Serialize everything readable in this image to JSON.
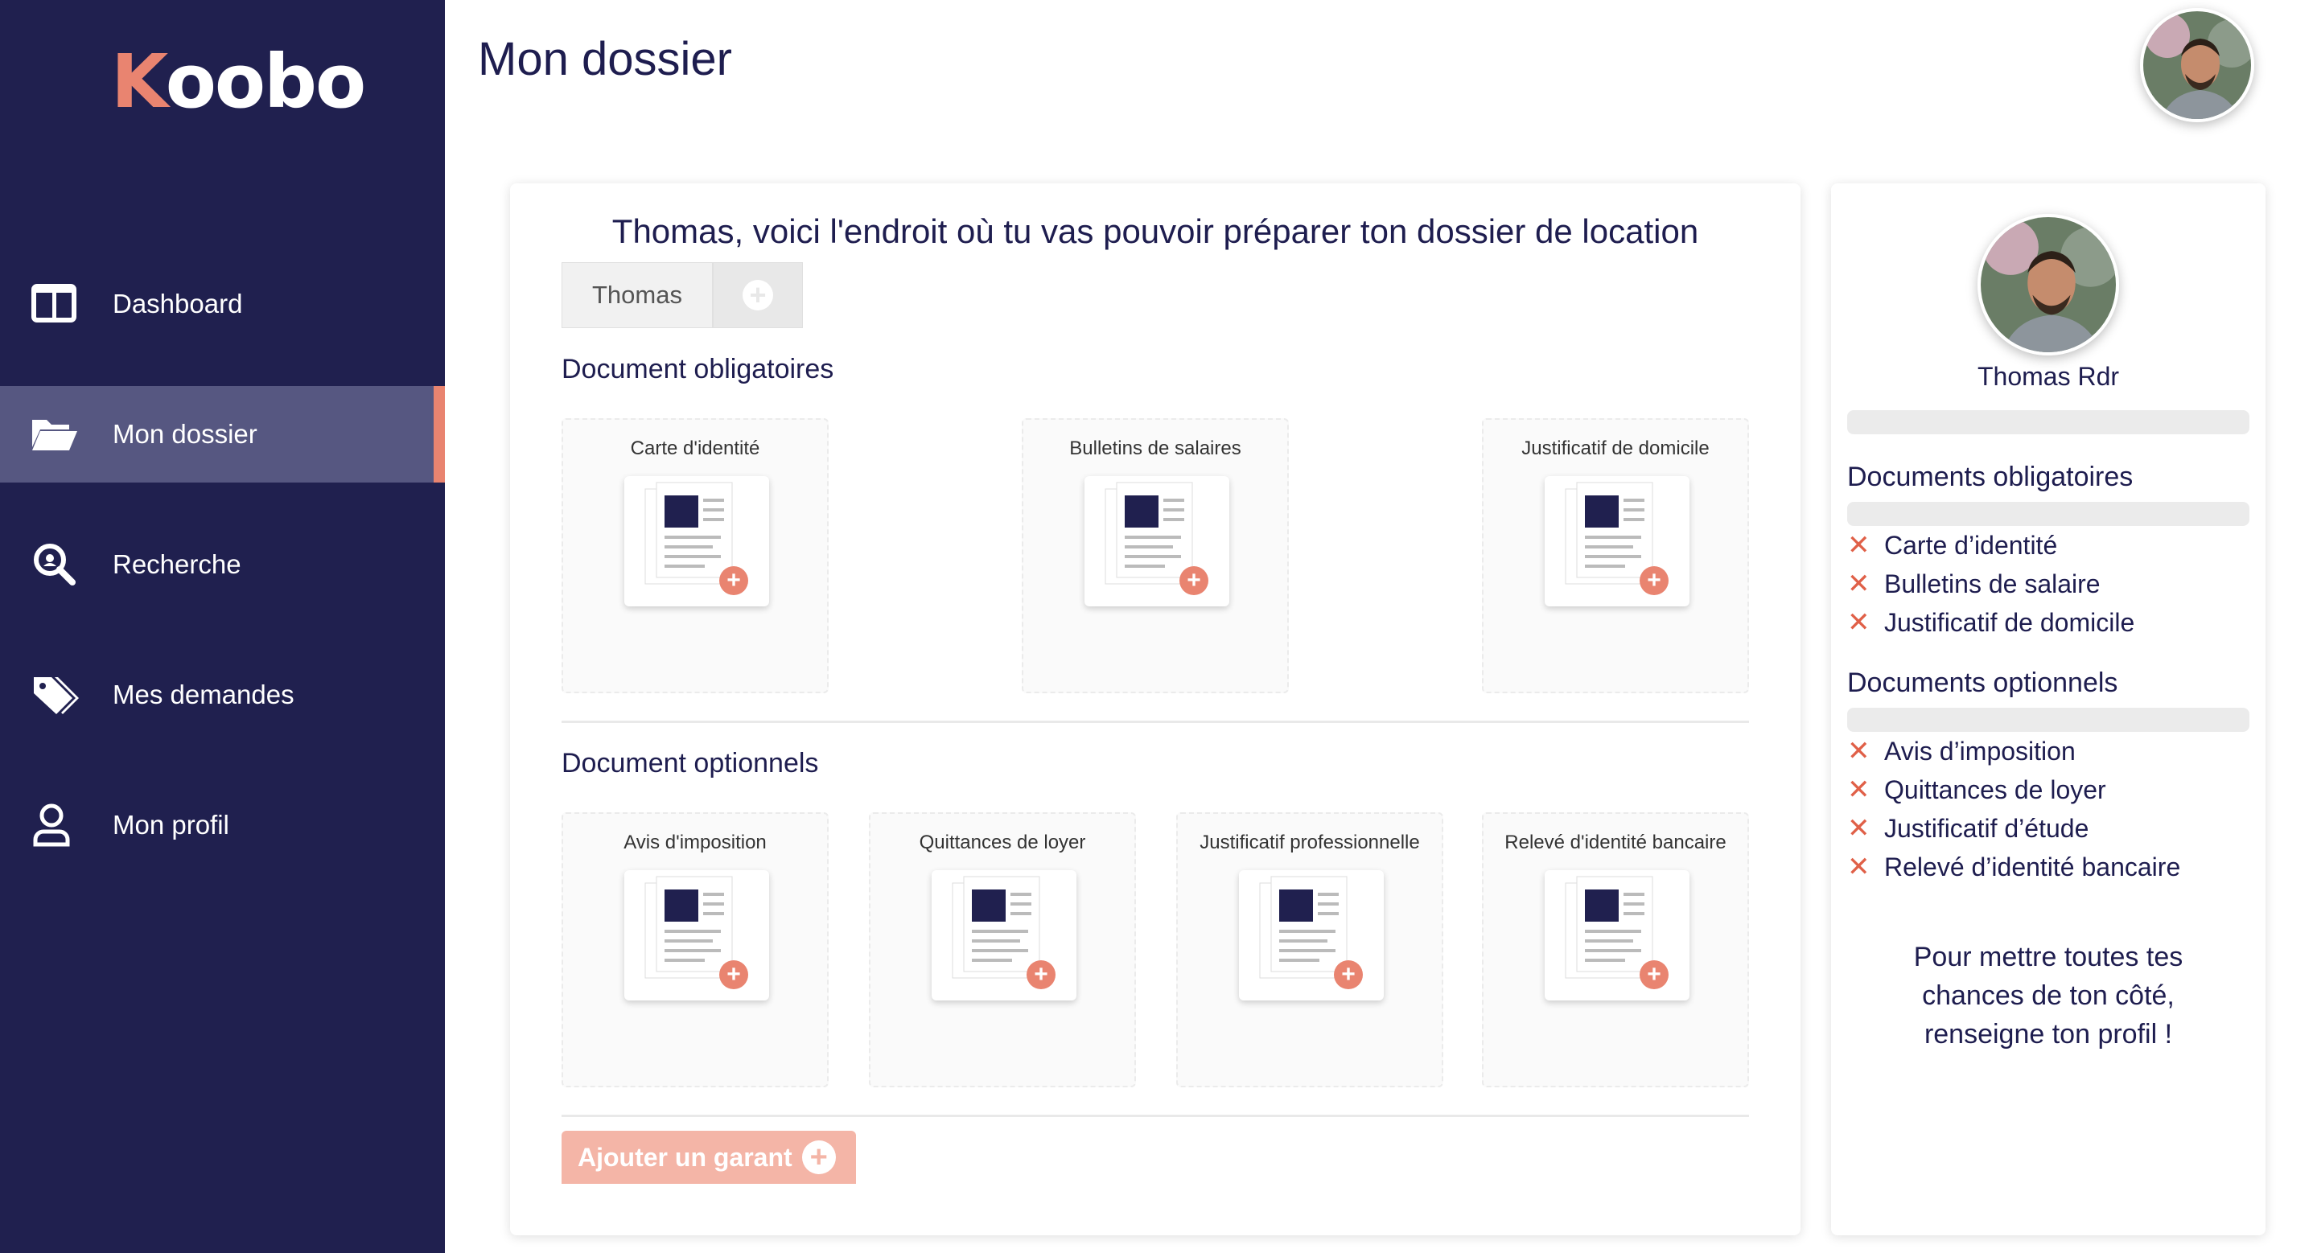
{
  "app": {
    "logo": "Koobo",
    "logo_first": "K",
    "logo_rest": "oobo",
    "accent": "#e98470",
    "sidebar_bg": "#20204f"
  },
  "sidebar": {
    "items": [
      {
        "label": "Dashboard",
        "icon": "dashboard-icon",
        "active": false
      },
      {
        "label": "Mon dossier",
        "icon": "folder-open-icon",
        "active": true
      },
      {
        "label": "Recherche",
        "icon": "search-icon",
        "active": false
      },
      {
        "label": "Mes demandes",
        "icon": "tags-icon",
        "active": false
      },
      {
        "label": "Mon profil",
        "icon": "user-icon",
        "active": false
      }
    ]
  },
  "header": {
    "title": "Mon dossier",
    "avatar_icon": "user-avatar"
  },
  "main": {
    "welcome": "Thomas, voici l'endroit où tu vas pouvoir préparer ton dossier de location",
    "tabs": [
      {
        "label": "Thomas"
      },
      {
        "label": "+"
      }
    ],
    "mandatory_title": "Document obligatoires",
    "mandatory_docs": [
      {
        "label": "Carte d'identité"
      },
      {
        "label": "Bulletins de salaires"
      },
      {
        "label": "Justificatif de domicile"
      }
    ],
    "optional_title": "Document optionnels",
    "optional_docs": [
      {
        "label": "Avis d'imposition"
      },
      {
        "label": "Quittances de loyer"
      },
      {
        "label": "Justificatif professionnelle"
      },
      {
        "label": "Relevé d'identité bancaire"
      }
    ],
    "add_guarantor": "Ajouter un garant"
  },
  "profile": {
    "name": "Thomas Rdr",
    "mandatory_title": "Documents obligatoires",
    "mandatory_items": [
      "Carte d’identité",
      "Bulletins de salaire",
      "Justificatif de domicile"
    ],
    "optional_title": "Documents optionnels",
    "optional_items": [
      "Avis d’imposition",
      "Quittances de loyer",
      "Justificatif d’étude",
      "Relevé d’identité bancaire"
    ],
    "missing_mark": "✕",
    "cta": "Pour mettre toutes tes chances de ton côté, renseigne ton profil !"
  }
}
